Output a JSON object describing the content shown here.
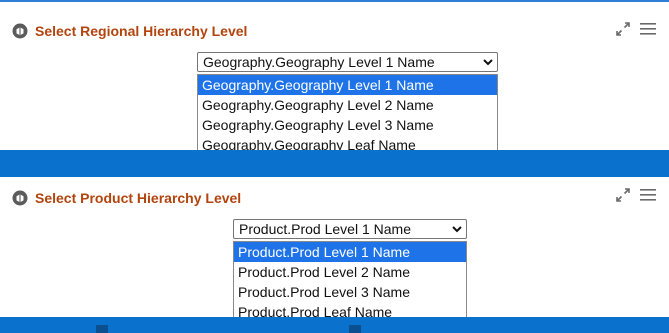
{
  "colors": {
    "accent_blue": "#0a72cc",
    "title_orange": "#b2440e",
    "selection_blue": "#1e73e8"
  },
  "panels": [
    {
      "title": "Select Regional Hierarchy Level",
      "icons": [
        "info-circle-icon",
        "expand-icon",
        "menu-icon"
      ],
      "select": {
        "value": "Geography.Geography Level 1 Name",
        "options": [
          "Geography.Geography Level 1 Name",
          "Geography.Geography Level 2 Name",
          "Geography.Geography Level 3 Name",
          "Geography.Geography Leaf Name"
        ],
        "highlighted_index": 0
      }
    },
    {
      "title": "Select Product Hierarchy Level",
      "icons": [
        "info-circle-icon",
        "expand-icon",
        "menu-icon"
      ],
      "select": {
        "value": "Product.Prod Level 1 Name",
        "options": [
          "Product.Prod Level 1 Name",
          "Product.Prod Level 2 Name",
          "Product.Prod Level 3 Name",
          "Product.Prod Leaf Name"
        ],
        "highlighted_index": 0
      }
    }
  ]
}
